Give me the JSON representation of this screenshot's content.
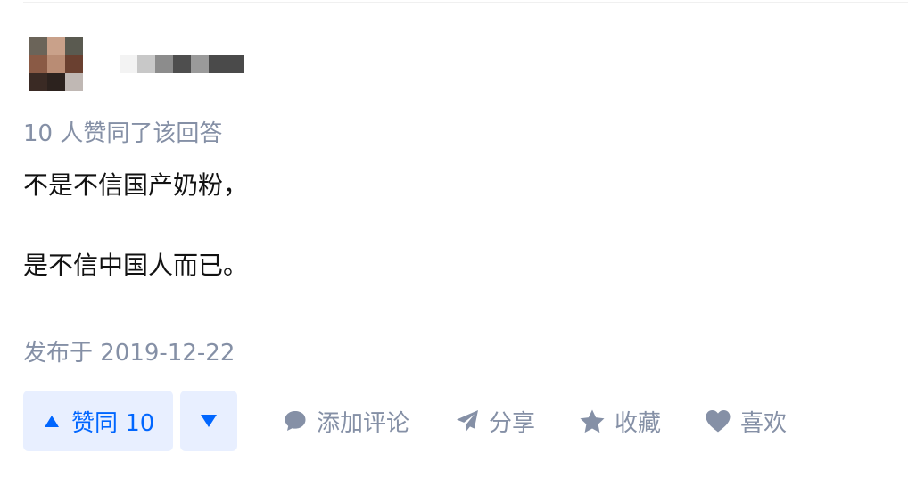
{
  "answer": {
    "voters_text": "10 人赞同了该回答",
    "content": [
      "不是不信国产奶粉，",
      "是不信中国人而已。"
    ],
    "published": "发布于 2019-12-22"
  },
  "actions": {
    "upvote_label": "赞同 10",
    "comment_label": "添加评论",
    "share_label": "分享",
    "favorite_label": "收藏",
    "like_label": "喜欢"
  },
  "colors": {
    "accent": "#0066ff",
    "accent_bg": "#e8efff",
    "meta_gray": "#8590a6",
    "text": "#121212"
  }
}
